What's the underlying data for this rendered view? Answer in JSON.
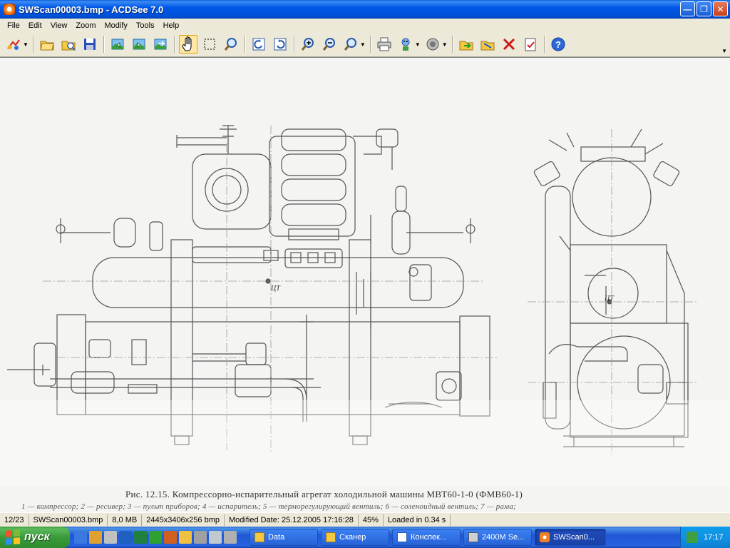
{
  "window": {
    "title": "SWScan00003.bmp - ACDSee 7.0",
    "controls": [
      "minimize",
      "maximize",
      "close"
    ]
  },
  "menu": [
    {
      "label": "File"
    },
    {
      "label": "Edit"
    },
    {
      "label": "View"
    },
    {
      "label": "Zoom"
    },
    {
      "label": "Modify"
    },
    {
      "label": "Tools"
    },
    {
      "label": "Help"
    }
  ],
  "toolbar": [
    "acquire-icon",
    "browse-icon",
    "open-folder-icon",
    "save-icon",
    "previous-image-icon",
    "next-image-icon",
    "auto-advance-icon",
    "hand-tool-icon",
    "select-tool-icon",
    "magnify-icon",
    "rotate-left-icon",
    "rotate-right-icon",
    "zoom-in-icon",
    "zoom-out-icon",
    "zoom-mode-icon",
    "print-icon",
    "slideshow-icon",
    "sound-icon",
    "copy-to-icon",
    "move-to-icon",
    "delete-icon",
    "properties-icon",
    "help-icon"
  ],
  "document": {
    "caption": "Рис. 12.15. Компрессорно-испарительный агрегат холодильной машины МВТ60-1-0 (ФМВ60-1)",
    "legend_line": "1 — компрессор; 2 — ресивер; 3 — пульт приборов; 4 — испаритель; 5 — терморегулирующий вентиль; 6 — соленоидный вентиль; 7 — рама;",
    "center_mark_left": "ЦТ",
    "center_mark_right": "ЦТ"
  },
  "status": {
    "position": "12/23",
    "filename": "SWScan00003.bmp",
    "filesize": "8,0 MB",
    "dimensions": "2445x3406x256 bmp",
    "modified": "Modified Date: 25.12.2005 17:16:28",
    "zoom": "45%",
    "loaded": "Loaded in 0.34 s"
  },
  "taskbar": {
    "start_label": "пуск",
    "tasks": [
      {
        "label": "Data",
        "icon": "folder-icon"
      },
      {
        "label": "Сканер",
        "icon": "folder-icon"
      },
      {
        "label": "Конспек...",
        "icon": "document-icon"
      },
      {
        "label": "2400M Se...",
        "icon": "scanner-icon"
      },
      {
        "label": "SWScan0...",
        "icon": "acdsee-icon",
        "active": true
      }
    ],
    "clock": "17:17"
  },
  "colors": {
    "titlebar": "#0058e6",
    "chrome": "#ece9d8",
    "taskbar": "#2157d7",
    "start": "#3a9b3a"
  }
}
